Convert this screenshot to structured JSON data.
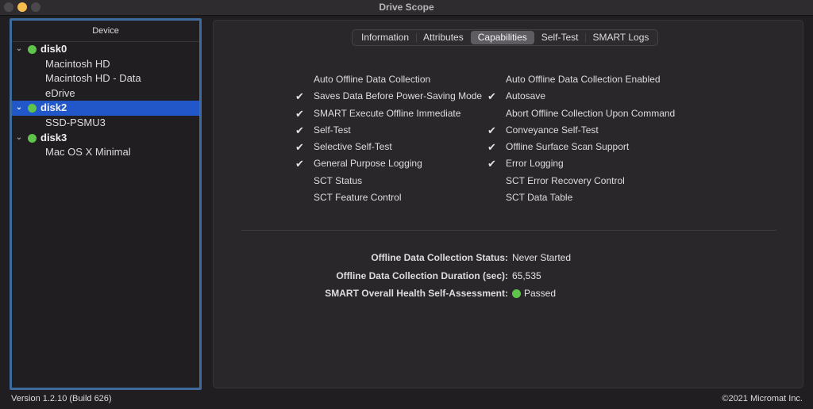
{
  "window": {
    "title": "Drive Scope"
  },
  "sidebar": {
    "header": "Device",
    "tree": [
      {
        "type": "disk",
        "label": "disk0",
        "status_color": "#5ec44b",
        "expanded": true,
        "selected": false
      },
      {
        "type": "volume",
        "label": "Macintosh HD"
      },
      {
        "type": "volume",
        "label": "Macintosh HD - Data"
      },
      {
        "type": "volume",
        "label": "eDrive"
      },
      {
        "type": "disk",
        "label": "disk2",
        "status_color": "#5ec44b",
        "expanded": true,
        "selected": true
      },
      {
        "type": "volume",
        "label": "SSD-PSMU3"
      },
      {
        "type": "disk",
        "label": "disk3",
        "status_color": "#5ec44b",
        "expanded": true,
        "selected": false
      },
      {
        "type": "volume",
        "label": "Mac OS X Minimal"
      }
    ],
    "chevron_glyph": "⌄"
  },
  "tabs": [
    {
      "label": "Information",
      "active": false
    },
    {
      "label": "Attributes",
      "active": false
    },
    {
      "label": "Capabilities",
      "active": true
    },
    {
      "label": "Self-Test",
      "active": false
    },
    {
      "label": "SMART Logs",
      "active": false
    }
  ],
  "capabilities": {
    "check_glyph": "✔",
    "left": [
      {
        "label": "Auto Offline Data Collection",
        "checked": false
      },
      {
        "label": "Saves Data Before Power-Saving Mode",
        "checked": true
      },
      {
        "label": "SMART Execute Offline Immediate",
        "checked": true
      },
      {
        "label": "Self-Test",
        "checked": true
      },
      {
        "label": "Selective Self-Test",
        "checked": true
      },
      {
        "label": "General Purpose Logging",
        "checked": true
      },
      {
        "label": "SCT Status",
        "checked": false
      },
      {
        "label": "SCT Feature Control",
        "checked": false
      }
    ],
    "right": [
      {
        "label": "Auto Offline Data Collection Enabled",
        "checked": false
      },
      {
        "label": "Autosave",
        "checked": true
      },
      {
        "label": "Abort Offline Collection Upon Command",
        "checked": false
      },
      {
        "label": "Conveyance Self-Test",
        "checked": true
      },
      {
        "label": "Offline Surface Scan Support",
        "checked": true
      },
      {
        "label": "Error Logging",
        "checked": true
      },
      {
        "label": "SCT Error Recovery Control",
        "checked": false
      },
      {
        "label": "SCT Data Table",
        "checked": false
      }
    ]
  },
  "summary": [
    {
      "label": "Offline Data Collection Status:",
      "value": "Never Started",
      "indicator": null
    },
    {
      "label": "Offline Data Collection Duration (sec):",
      "value": "65,535",
      "indicator": null
    },
    {
      "label": "SMART Overall Health Self-Assessment:",
      "value": "Passed",
      "indicator": "#5ec44b"
    }
  ],
  "footer": {
    "version": "Version 1.2.10 (Build 626)",
    "copyright": "©2021 Micromat Inc."
  }
}
